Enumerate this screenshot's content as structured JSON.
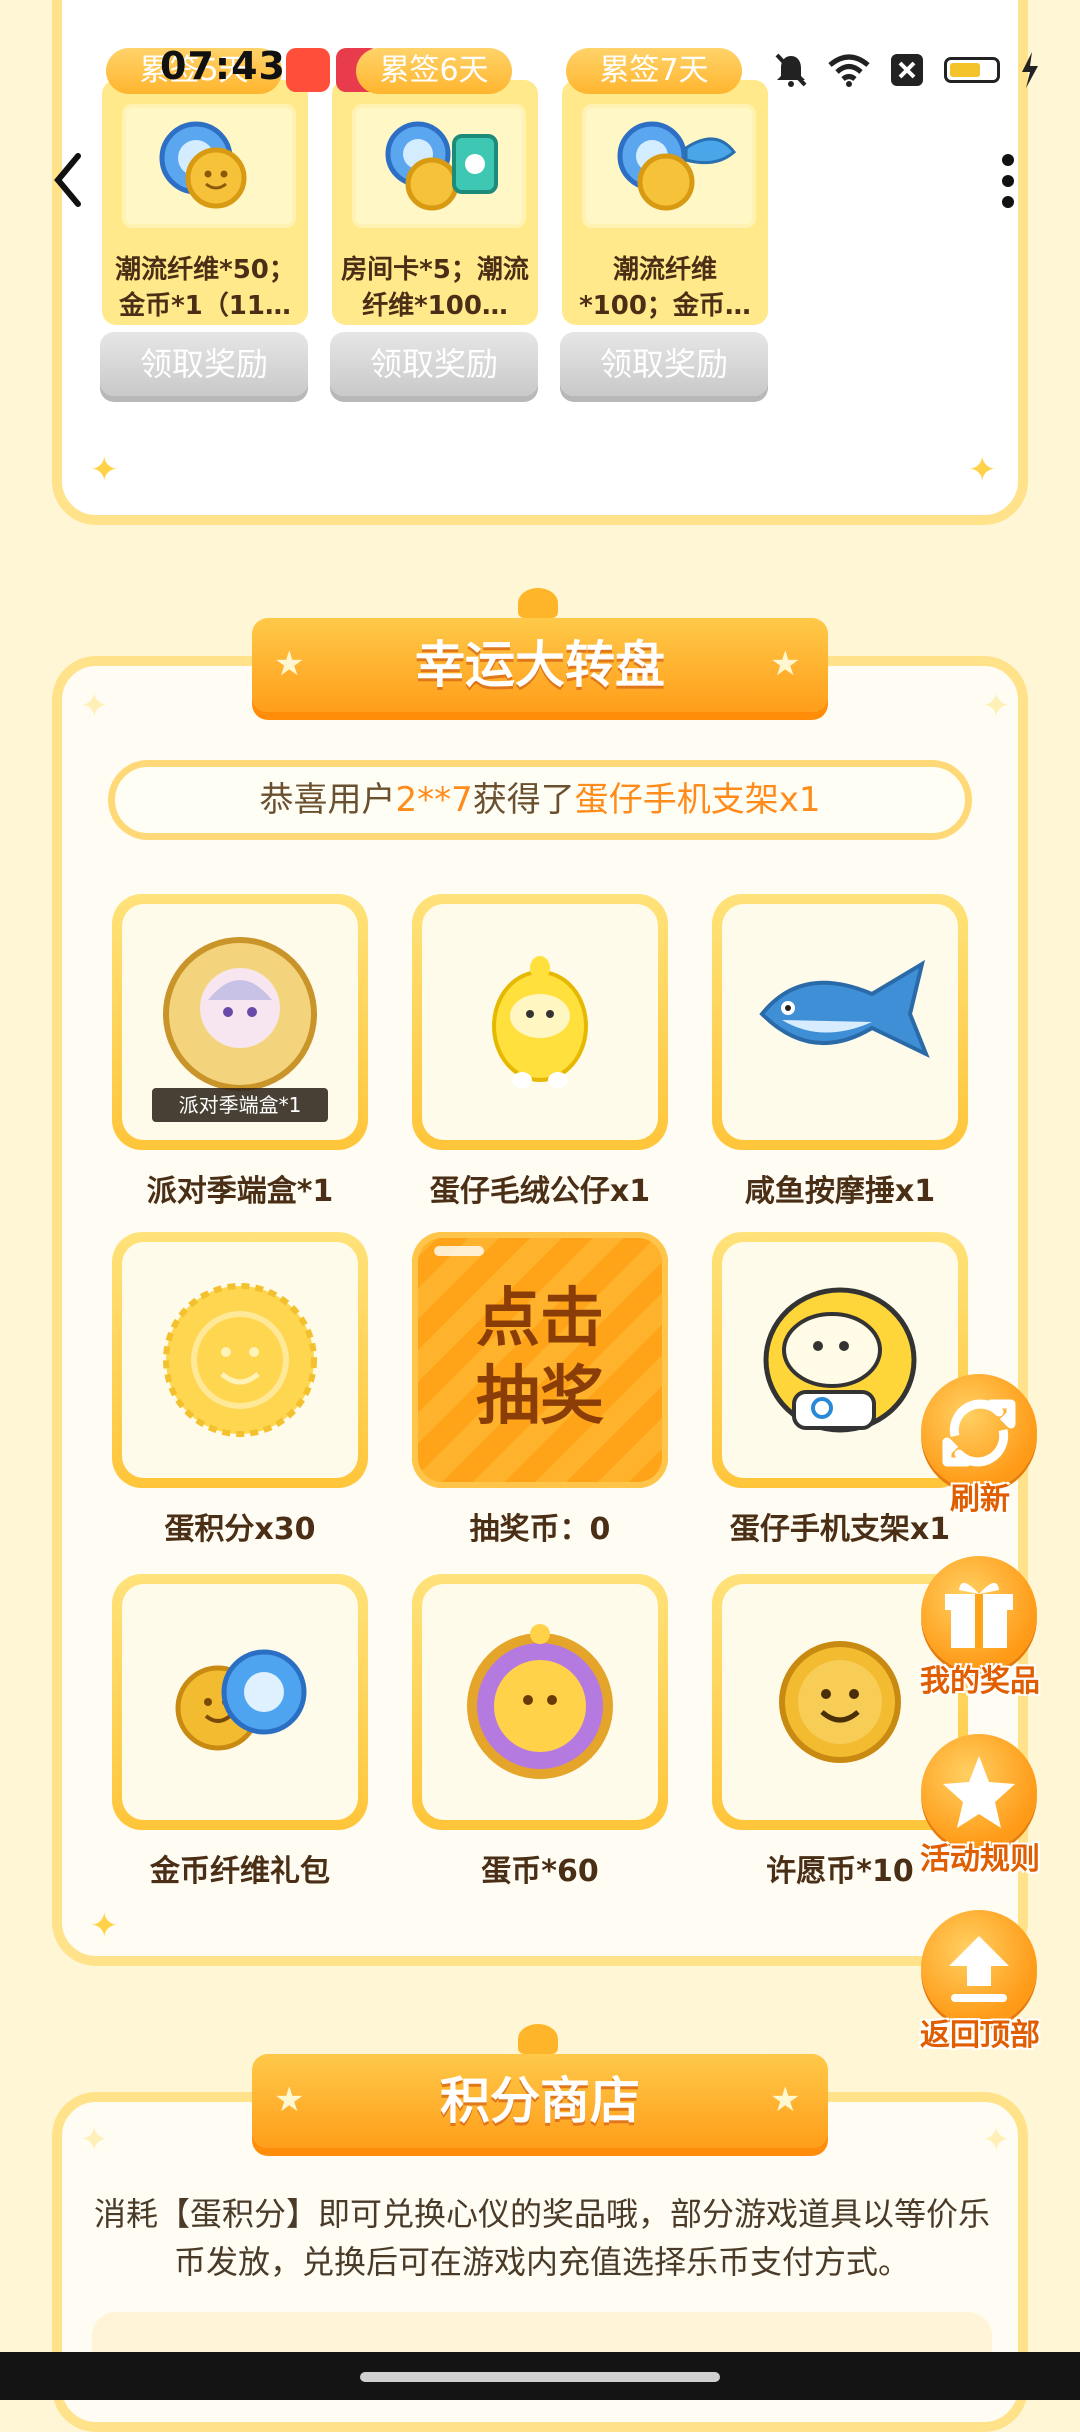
{
  "status_bar": {
    "time": "07:43",
    "streak_pills": [
      "累签5天",
      "累签6天",
      "累签7天"
    ],
    "icons": [
      "app-icon-shopping",
      "app-icon-red",
      "mute-icon",
      "wifi-icon",
      "close-box-icon",
      "battery-icon",
      "charging-icon"
    ]
  },
  "checkin": {
    "rewards": [
      {
        "text": "潮流纤维*50；金币*1（11…",
        "button": "领取奖励"
      },
      {
        "text": "房间卡*5；潮流纤维*100…",
        "button": "领取奖励"
      },
      {
        "text": "潮流纤维*100；金币…",
        "button": "领取奖励"
      }
    ]
  },
  "wheel": {
    "title": "幸运大转盘",
    "announcement": {
      "prefix": "恭喜用户",
      "user": "2**7",
      "middle": "获得了",
      "prize": "蛋仔手机支架x1"
    },
    "prizes": [
      {
        "label": "派对季端盒*1",
        "badge": "派对季端盒*1"
      },
      {
        "label": "蛋仔毛绒公仔x1"
      },
      {
        "label": "咸鱼按摩捶x1"
      },
      {
        "label": "蛋积分x30"
      },
      {
        "label": "抽奖币：0",
        "button_line1": "点击",
        "button_line2": "抽奖"
      },
      {
        "label": "蛋仔手机支架x1"
      },
      {
        "label": "金币纤维礼包"
      },
      {
        "label": "蛋币*60"
      },
      {
        "label": "许愿币*10"
      }
    ]
  },
  "side_buttons": [
    {
      "label": "刷新",
      "icon": "refresh-icon"
    },
    {
      "label": "我的奖品",
      "icon": "gift-icon"
    },
    {
      "label": "活动规则",
      "icon": "star-icon"
    },
    {
      "label": "返回顶部",
      "icon": "upload-arrow-icon"
    }
  ],
  "shop": {
    "title": "积分商店",
    "description": "消耗【蛋积分】即可兑换心仪的奖品哦，部分游戏道具以等价乐币发放，兑换后可在游戏内充值选择乐币支付方式。"
  },
  "colors": {
    "accent": "#ffa418",
    "accent_text": "#ff8b1a",
    "card_border": "#ffe28a",
    "background": "#fff6d6"
  }
}
